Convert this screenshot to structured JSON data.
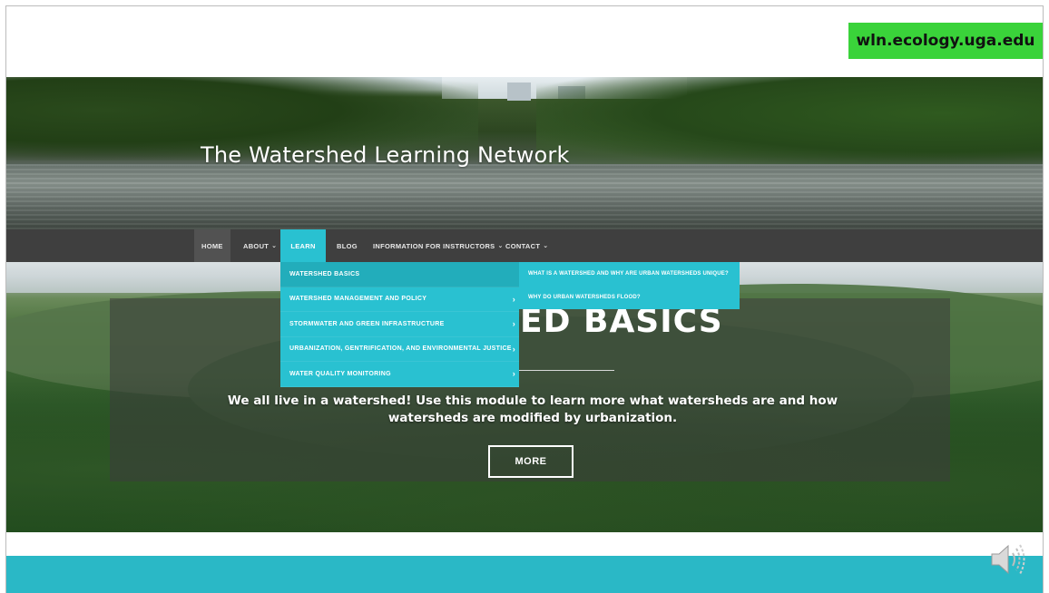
{
  "slide": {
    "url_badge": "wln.ecology.uga.edu"
  },
  "site": {
    "title": "The Watershed Learning Network"
  },
  "nav": {
    "items": [
      {
        "label": "HOME"
      },
      {
        "label": "ABOUT"
      },
      {
        "label": "LEARN"
      },
      {
        "label": "BLOG"
      },
      {
        "label": "INFORMATION FOR INSTRUCTORS"
      },
      {
        "label": "CONTACT"
      }
    ]
  },
  "learn_menu": {
    "items": [
      {
        "label": "WATERSHED BASICS"
      },
      {
        "label": "WATERSHED MANAGEMENT AND POLICY"
      },
      {
        "label": "STORMWATER AND GREEN INFRASTRUCTURE"
      },
      {
        "label": "URBANIZATION, GENTRIFICATION, AND ENVIRONMENTAL JUSTICE"
      },
      {
        "label": "WATER QUALITY MONITORING"
      }
    ],
    "submenu": [
      {
        "label": "WHAT IS A WATERSHED AND WHY ARE URBAN WATERSHEDS UNIQUE?"
      },
      {
        "label": "WHY DO URBAN WATERSHEDS FLOOD?"
      }
    ]
  },
  "module": {
    "title_visible": "ED BASICS",
    "description": "We all live in a watershed! Use this module to learn more what watersheds are and how watersheds are modified by urbanization.",
    "more_label": "MORE"
  },
  "colors": {
    "accent": "#29c1d1",
    "navbar": "#3f3f3f",
    "badge": "#3ad33a"
  },
  "icons": {
    "audio": "speaker-icon"
  }
}
